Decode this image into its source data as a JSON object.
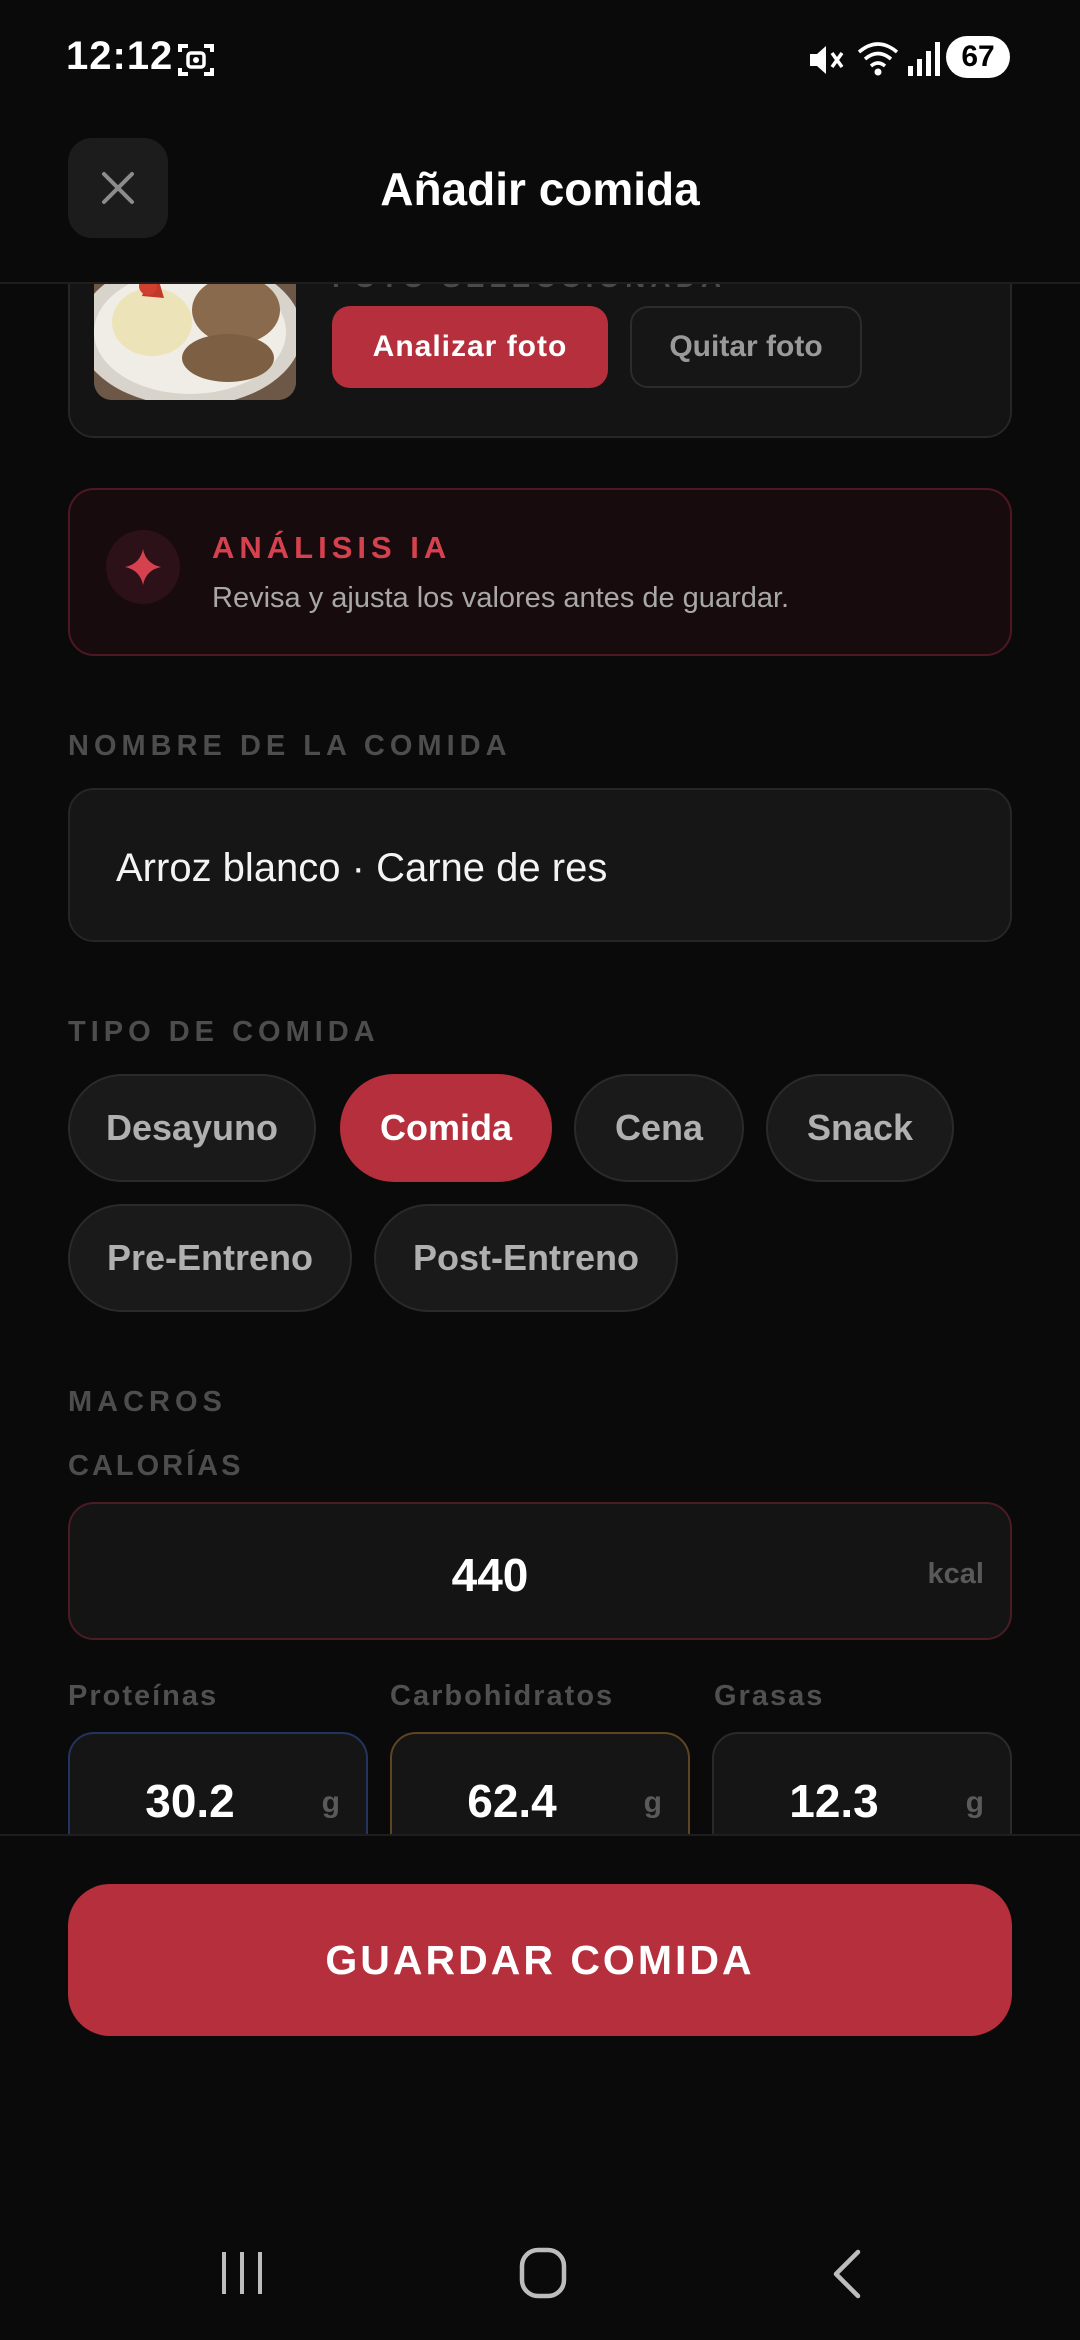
{
  "status_bar": {
    "time": "12:12",
    "battery": "67"
  },
  "header": {
    "title": "Añadir comida"
  },
  "photo": {
    "caption": "FOTO SELECCIONADA",
    "analyze_label": "Analizar foto",
    "remove_label": "Quitar foto"
  },
  "ai_analysis": {
    "title": "ANÁLISIS IA",
    "subtitle": "Revisa y ajusta los valores antes de guardar."
  },
  "meal_name": {
    "label": "NOMBRE DE LA COMIDA",
    "value": "Arroz blanco · Carne de res"
  },
  "meal_type": {
    "label": "TIPO DE COMIDA",
    "options": [
      "Desayuno",
      "Comida",
      "Cena",
      "Snack",
      "Pre-Entreno",
      "Post-Entreno"
    ],
    "selected": "Comida"
  },
  "macros": {
    "label": "MACROS",
    "calories_label": "CALORÍAS",
    "calories_value": "440",
    "calories_unit": "kcal",
    "items": [
      {
        "label": "Proteínas",
        "value": "30.2",
        "unit": "g"
      },
      {
        "label": "Carbohidratos",
        "value": "62.4",
        "unit": "g"
      },
      {
        "label": "Grasas",
        "value": "12.3",
        "unit": "g"
      }
    ]
  },
  "save_label": "GUARDAR COMIDA",
  "colors": {
    "accent": "#b52f3c",
    "background": "#0a0a0a",
    "protein_border": "#24345e",
    "carbs_border": "#5d4522"
  }
}
